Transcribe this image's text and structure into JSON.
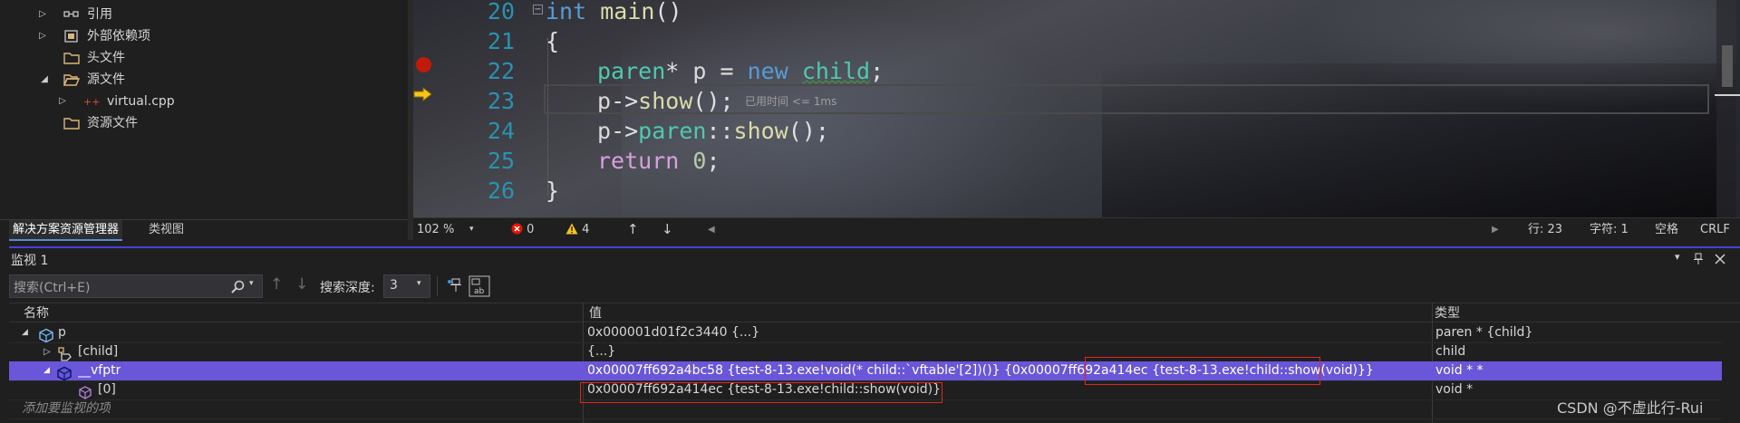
{
  "solution_explorer": {
    "items": [
      {
        "label": "引用",
        "icon": "references-icon",
        "expandable": true
      },
      {
        "label": "外部依赖项",
        "icon": "external-deps-icon",
        "expandable": true
      },
      {
        "label": "头文件",
        "icon": "folder-icon",
        "expandable": false
      },
      {
        "label": "源文件",
        "icon": "folder-open-icon",
        "expandable": true,
        "expanded": true
      },
      {
        "label": "virtual.cpp",
        "icon": "cpp-file-icon",
        "expandable": true
      },
      {
        "label": "资源文件",
        "icon": "folder-icon",
        "expandable": false
      }
    ],
    "tabs": [
      {
        "label": "解决方案资源管理器",
        "active": true
      },
      {
        "label": "类视图",
        "active": false
      }
    ]
  },
  "editor": {
    "lines": [
      {
        "number": "20",
        "text": "int main()"
      },
      {
        "number": "21",
        "text": "{"
      },
      {
        "number": "22",
        "text": "paren* p = new child;"
      },
      {
        "number": "23",
        "text": "p->show();"
      },
      {
        "number": "24",
        "text": "p->paren::show();"
      },
      {
        "number": "25",
        "text": "return 0;"
      },
      {
        "number": "26",
        "text": "}"
      }
    ],
    "elapsed_hint": "已用时间 <= 1ms",
    "breakpoint_line": "22",
    "current_line": "23"
  },
  "statusbar": {
    "zoom": "102 %",
    "errors": "0",
    "warnings": "4",
    "line": "行: 23",
    "char": "字符: 1",
    "whitespace": "空格",
    "line_ending": "CRLF"
  },
  "watch": {
    "title": "监视 1",
    "search_placeholder": "搜索(Ctrl+E)",
    "search_depth_label": "搜索深度:",
    "search_depth_value": "3",
    "columns": {
      "name": "名称",
      "value": "值",
      "type": "类型"
    },
    "rows": [
      {
        "name": "p",
        "value": "0x000001d01f2c3440 {...}",
        "type": "paren * {child}",
        "expander": "expanded",
        "selected": false
      },
      {
        "name": "[child]",
        "value": "{...}",
        "type": "child",
        "expander": "collapsed",
        "selected": false
      },
      {
        "name": "__vfptr",
        "value": "0x00007ff692a4bc58 {test-8-13.exe!void(* child::`vftable'[2])()} {0x00007ff692a414ec {test-8-13.exe!child::show(void)}}",
        "type": "void * *",
        "expander": "expanded",
        "selected": true
      },
      {
        "name": "[0]",
        "value": "0x00007ff692a414ec {test-8-13.exe!child::show(void)}",
        "type": "void *",
        "expander": "none",
        "selected": false
      }
    ],
    "add_placeholder": "添加要监视的项"
  },
  "watermark": "CSDN @不虚此行-Rui",
  "colors": {
    "accent": "#4b3fd6",
    "selection": "#6a56d9",
    "highlight_box": "#e0281e",
    "breakpoint": "#e51400"
  }
}
